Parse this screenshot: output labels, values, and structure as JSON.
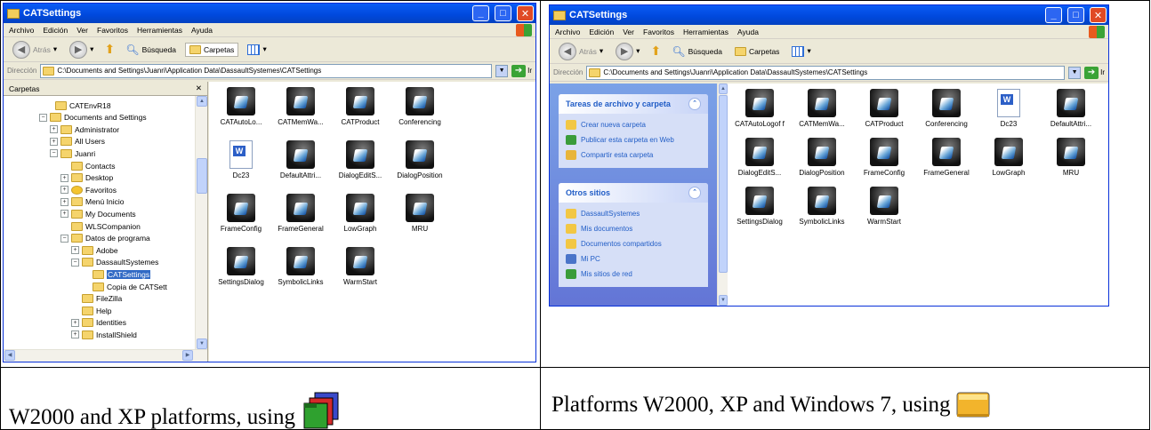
{
  "left_window": {
    "title": "CATSettings",
    "menu": [
      "Archivo",
      "Edición",
      "Ver",
      "Favoritos",
      "Herramientas",
      "Ayuda"
    ],
    "toolbar": {
      "back": "Atrás",
      "search": "Búsqueda",
      "folders": "Carpetas"
    },
    "address": {
      "label": "Dirección",
      "path": "C:\\Documents and Settings\\Juanri\\Application Data\\DassaultSystemes\\CATSettings",
      "go": "Ir"
    },
    "tree_title": "Carpetas",
    "tree": [
      {
        "label": "CATEnvR18",
        "pm": ""
      },
      {
        "label": "Documents and Settings",
        "pm": "−"
      },
      {
        "label": "Administrator",
        "pm": "+"
      },
      {
        "label": "All Users",
        "pm": "+"
      },
      {
        "label": "Juanri",
        "pm": "−"
      },
      {
        "label": "Contacts",
        "pm": ""
      },
      {
        "label": "Desktop",
        "pm": "+"
      },
      {
        "label": "Favoritos",
        "pm": "+"
      },
      {
        "label": "Menú Inicio",
        "pm": "+"
      },
      {
        "label": "My Documents",
        "pm": "+"
      },
      {
        "label": "WLSCompanion",
        "pm": ""
      },
      {
        "label": "Datos de programa",
        "pm": "−"
      },
      {
        "label": "Adobe",
        "pm": "+"
      },
      {
        "label": "DassaultSystemes",
        "pm": "−"
      },
      {
        "label": "CATSettings",
        "pm": ""
      },
      {
        "label": "Copia de CATSett",
        "pm": ""
      },
      {
        "label": "FileZilla",
        "pm": ""
      },
      {
        "label": "Help",
        "pm": ""
      },
      {
        "label": "Identities",
        "pm": "+"
      },
      {
        "label": "InstallShield",
        "pm": "+"
      }
    ],
    "files": [
      "CATAutoLo...",
      "CATMemWa...",
      "CATProduct",
      "Conferencing",
      "Dc23",
      "DefaultAttri...",
      "DialogEditS...",
      "DialogPosition",
      "FrameConfig",
      "FrameGeneral",
      "LowGraph",
      "MRU",
      "SettingsDialog",
      "SymbolicLinks",
      "WarmStart"
    ]
  },
  "right_window": {
    "title": "CATSettings",
    "menu": [
      "Archivo",
      "Edición",
      "Ver",
      "Favoritos",
      "Herramientas",
      "Ayuda"
    ],
    "toolbar": {
      "back": "Atrás",
      "search": "Búsqueda",
      "folders": "Carpetas"
    },
    "address": {
      "label": "Dirección",
      "path": "C:\\Documents and Settings\\Juanri\\Application Data\\DassaultSystemes\\CATSettings",
      "go": "Ir"
    },
    "tasks_title": "Tareas de archivo y carpeta",
    "tasks": [
      "Crear nueva carpeta",
      "Publicar esta carpeta en Web",
      "Compartir esta carpeta"
    ],
    "places_title": "Otros sitios",
    "places": [
      "DassaultSystemes",
      "Mis documentos",
      "Documentos compartidos",
      "Mi PC",
      "Mis sitios de red"
    ],
    "files": [
      "CATAutoLogof f",
      "CATMemWa...",
      "CATProduct",
      "Conferencing",
      "Dc23",
      "DefaultAttri...",
      "DialogEditS...",
      "DialogPosition",
      "FrameConfig",
      "FrameGeneral",
      "LowGraph",
      "MRU",
      "SettingsDialog",
      "SymbolicLinks",
      "WarmStart"
    ]
  },
  "captions": {
    "left": "W2000 and XP platforms, using",
    "right": "Platforms W2000, XP and Windows 7, using"
  }
}
